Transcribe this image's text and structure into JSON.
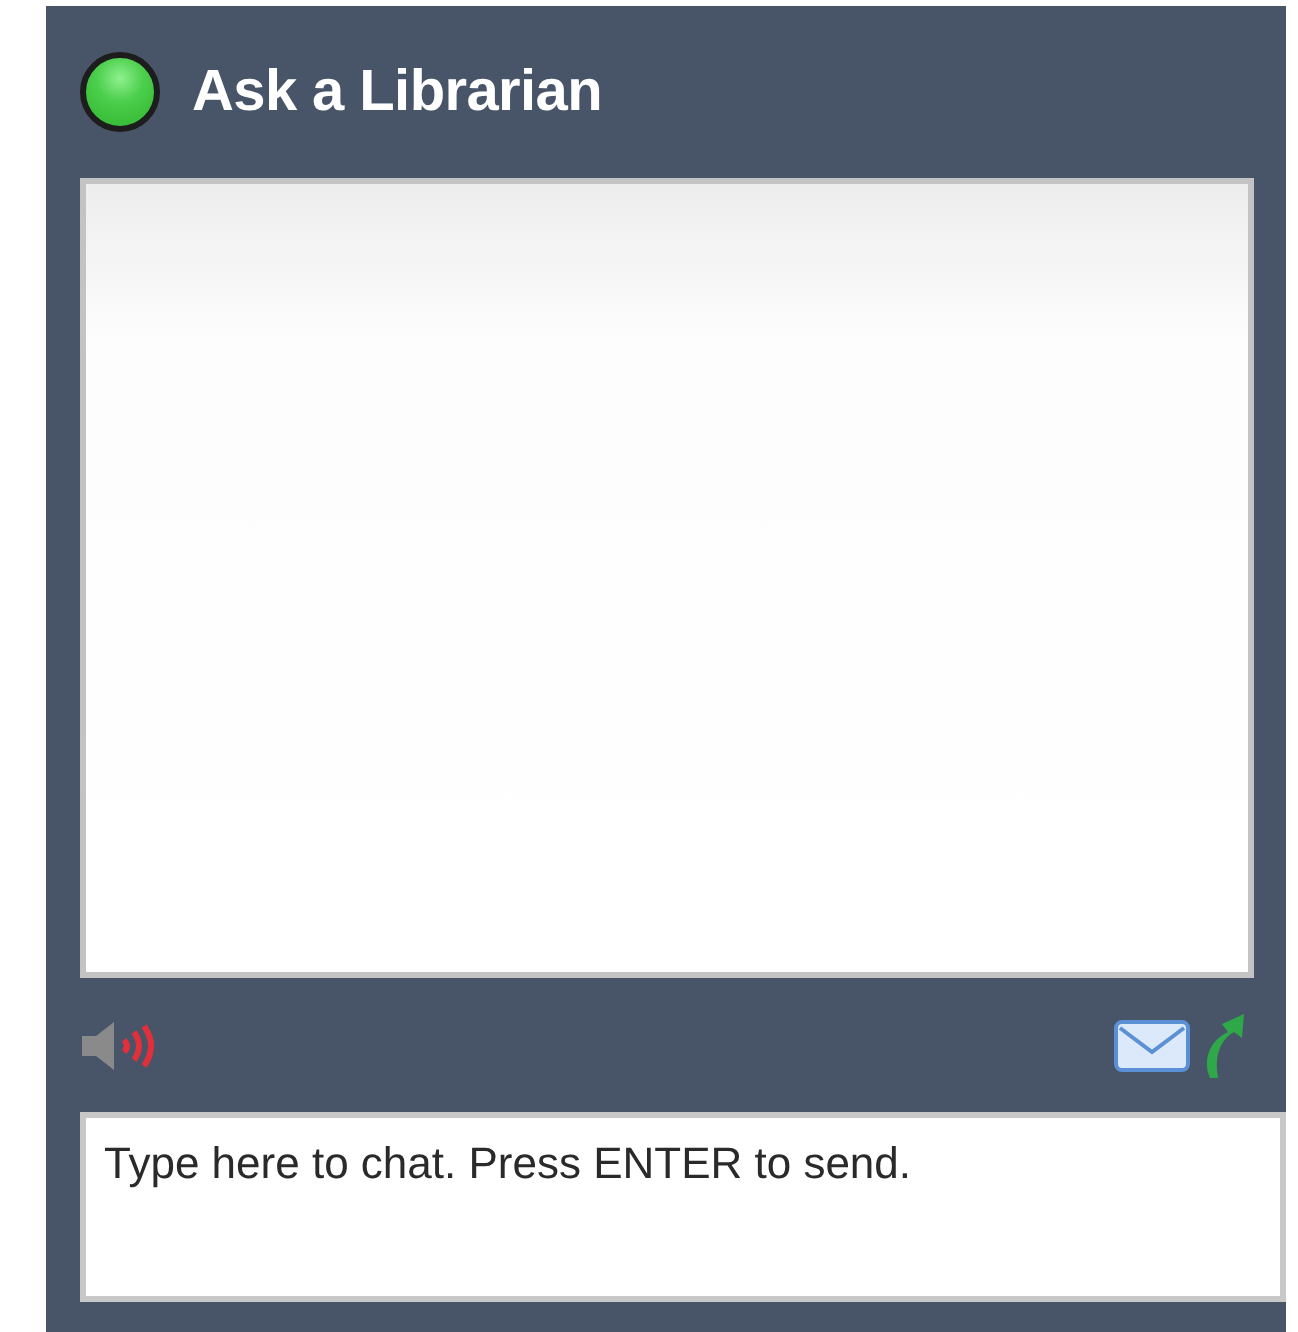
{
  "header": {
    "title": "Ask a Librarian",
    "online": true
  },
  "chat_input": {
    "placeholder": "Type here to chat. Press ENTER to send."
  }
}
